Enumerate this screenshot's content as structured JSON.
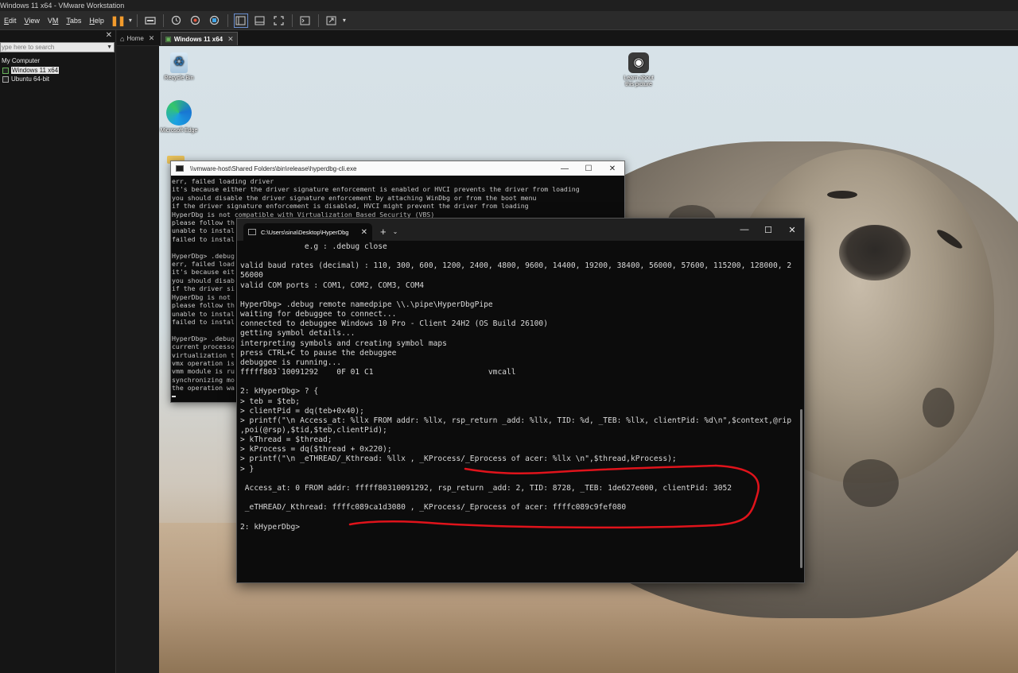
{
  "window": {
    "title": "Windows 11 x64 - VMware Workstation"
  },
  "menu": [
    {
      "label": "Edit",
      "accel": "E"
    },
    {
      "label": "View",
      "accel": "V"
    },
    {
      "label": "VM",
      "accel": "M"
    },
    {
      "label": "Tabs",
      "accel": "T"
    },
    {
      "label": "Help",
      "accel": "H"
    }
  ],
  "toolbar": {
    "pause_glyph": "❚❚",
    "dropdown_glyph": "▾",
    "icons": [
      "send-ctrl-alt-del-icon",
      "snapshot-icon",
      "revert-snapshot-icon",
      "snapshot-manager-icon",
      "library-view-icon",
      "thumbnail-bar-icon",
      "full-screen-icon",
      "console-view-icon",
      "stretch-guest-icon"
    ]
  },
  "library": {
    "close_glyph": "✕",
    "search_placeholder": "ype here to search",
    "root_label": "My Computer",
    "vms": [
      {
        "label": "Windows 11 x64",
        "selected": true
      },
      {
        "label": "Ubuntu 64-bit",
        "selected": false
      }
    ]
  },
  "tabs": [
    {
      "label": "Home",
      "icon": "home-icon",
      "close": "✕"
    },
    {
      "label": "Windows 11 x64",
      "icon": "vm-icon",
      "close": "✕"
    }
  ],
  "desktop": {
    "icons": [
      {
        "label": "Recycle Bin"
      },
      {
        "label": "Microsoft Edge"
      },
      {
        "label": "Learn about this picture"
      }
    ]
  },
  "conhost": {
    "title": "\\\\vmware-host\\Shared Folders\\bin\\release\\hyperdbg-cli.exe",
    "controls": [
      "—",
      "☐",
      "✕"
    ],
    "lines": [
      "err, failed loading driver",
      "it's because either the driver signature enforcement is enabled or HVCI prevents the driver from loading",
      "you should disable the driver signature enforcement by attaching WinDbg or from the boot menu",
      "if the driver signature enforcement is disabled, HVCI might prevent the driver from loading",
      "HyperDbg is not compatible with Virtualization Based Security (VBS)",
      "please follow th",
      "unable to instal",
      "failed to instal",
      "",
      "HyperDbg> .debug",
      "err, failed load",
      "it's because eit",
      "you should disab",
      "if the driver si",
      "HyperDbg is not",
      "please follow th",
      "unable to instal",
      "failed to instal",
      "",
      "HyperDbg> .debug",
      "current processo",
      "virtualization t",
      "vmx operation is",
      "vmm module is ru",
      "synchronizing mo",
      "the operation wa"
    ]
  },
  "terminal": {
    "tab_title": "C:\\Users\\sina\\Desktop\\HyperDbg",
    "tab_close": "✕",
    "new_tab": "+",
    "dropdown": "⌄",
    "controls": [
      "—",
      "☐",
      "✕"
    ],
    "lines": [
      "              e.g : .debug close",
      "",
      "valid baud rates (decimal) : 110, 300, 600, 1200, 2400, 4800, 9600, 14400, 19200, 38400, 56000, 57600, 115200, 128000, 2",
      "56000",
      "valid COM ports : COM1, COM2, COM3, COM4",
      "",
      "HyperDbg> .debug remote namedpipe \\\\.\\pipe\\HyperDbgPipe",
      "waiting for debuggee to connect...",
      "connected to debuggee Windows 10 Pro - Client 24H2 (OS Build 26100)",
      "getting symbol details...",
      "interpreting symbols and creating symbol maps",
      "press CTRL+C to pause the debuggee",
      "debuggee is running...",
      "fffff803`10091292    0F 01 C1                         vmcall",
      "",
      "2: kHyperDbg> ? {",
      "> teb = $teb;",
      "> clientPid = dq(teb+0x40);",
      "> printf(\"\\n Access_at: %llx FROM addr: %llx, rsp_return _add: %llx, TID: %d, _TEB: %llx, clientPid: %d\\n\",$context,@rip",
      ",poi(@rsp),$tid,$teb,clientPid);",
      "> kThread = $thread;",
      "> kProcess = dq($thread + 0x220);",
      "> printf(\"\\n _eTHREAD/_Kthread: %llx , _KProcess/_Eprocess of acer: %llx \\n\",$thread,kProcess);",
      "> }",
      "",
      " Access_at: 0 FROM addr: fffff80310091292, rsp_return _add: 2, TID: 8728, _TEB: 1de627e000, clientPid: 3052",
      "",
      " _eTHREAD/_Kthread: ffffc089ca1d3080 , _KProcess/_Eprocess of acer: ffffc089c9fef080",
      "",
      "2: kHyperDbg>"
    ]
  },
  "colors": {
    "annotation": "#e0131b",
    "pause": "#f39b2c",
    "terminal_bg": "#0c0c0c"
  }
}
